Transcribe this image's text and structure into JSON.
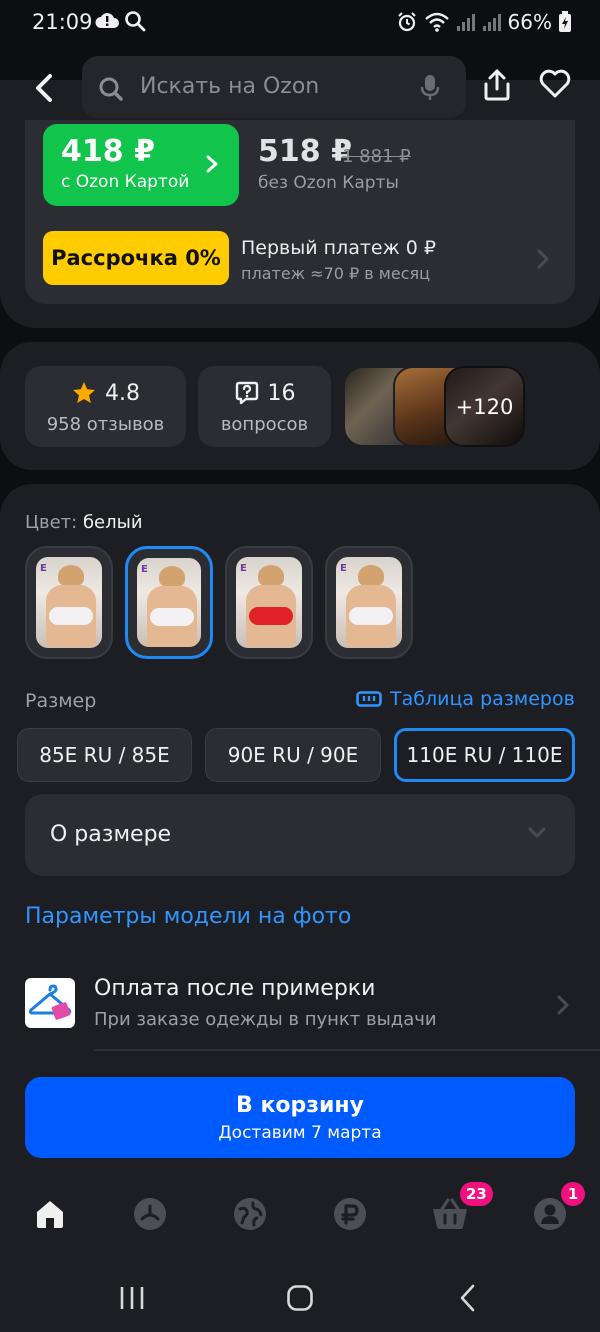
{
  "status_bar": {
    "time": "21:09",
    "battery": "66%"
  },
  "header": {
    "search_placeholder": "Искать на Ozon"
  },
  "price": {
    "ozon_card_price": "418 ₽",
    "ozon_card_label": "с Ozon Картой",
    "regular_price": "518 ₽",
    "old_price": "1 881 ₽",
    "regular_label": "без Ozon Карты",
    "installment_badge": "Рассрочка 0%",
    "installment_title": "Первый платеж 0 ₽",
    "installment_sub": "платеж ≈70 ₽ в месяц"
  },
  "stats": {
    "rating": "4.8",
    "reviews": "958 отзывов",
    "questions_count": "16",
    "questions_label": "вопросов",
    "more_photos": "+120"
  },
  "color": {
    "label": "Цвет:",
    "value": "белый",
    "swatches": [
      {
        "name": "white-1",
        "selected": false
      },
      {
        "name": "white-2",
        "selected": true
      },
      {
        "name": "red",
        "selected": false
      },
      {
        "name": "white-3",
        "selected": false
      }
    ]
  },
  "size": {
    "label": "Размер",
    "table_link": "Таблица размеров",
    "options": [
      "85E RU / 85E",
      "90E RU / 90E",
      "110E RU / 110E"
    ],
    "selected_index": 2
  },
  "about_size": {
    "label": "О размере"
  },
  "model_params_link": "Параметры модели на фото",
  "fitting": {
    "title": "Оплата после примерки",
    "subtitle": "При заказе одежды в пункт выдачи"
  },
  "cart": {
    "label": "В корзину",
    "sub": "Доставим 7 марта"
  },
  "bottom_nav": {
    "cart_badge": "23",
    "profile_badge": "1"
  },
  "colors": {
    "accent_blue": "#005bff",
    "link_blue": "#2f96ff",
    "ozon_green": "#10c44c",
    "installment_yellow": "#ffcc00",
    "badge_pink": "#f1117e"
  }
}
